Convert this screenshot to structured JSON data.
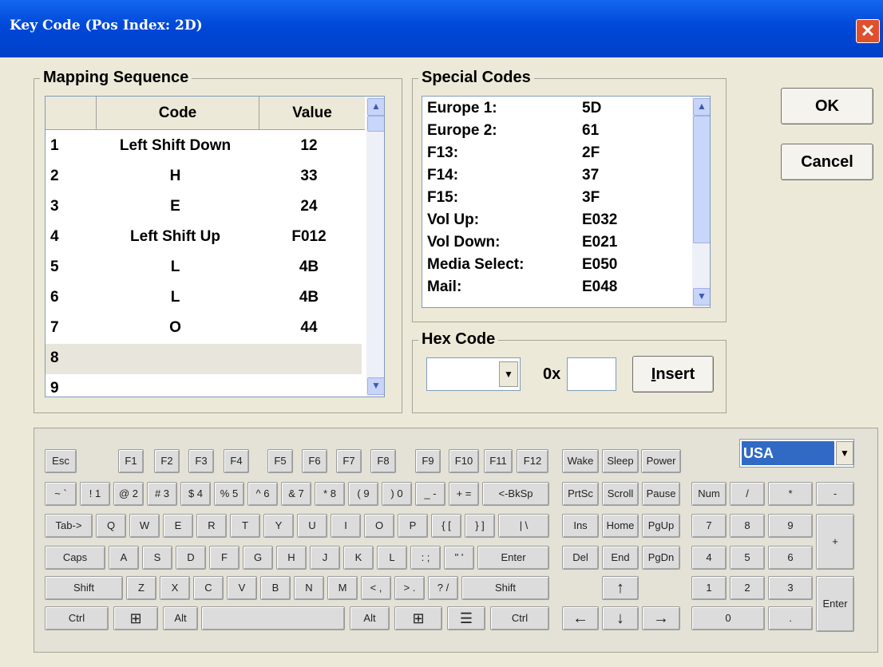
{
  "window": {
    "title": "Key Code (Pos Index: 2D)",
    "close_glyph": "✕"
  },
  "mapping": {
    "group_label": "Mapping Sequence",
    "headers": {
      "index": "",
      "code": "Code",
      "value": "Value"
    },
    "rows": [
      {
        "n": "1",
        "code": "Left Shift Down",
        "value": "12"
      },
      {
        "n": "2",
        "code": "H",
        "value": "33"
      },
      {
        "n": "3",
        "code": "E",
        "value": "24"
      },
      {
        "n": "4",
        "code": "Left Shift Up",
        "value": "F012"
      },
      {
        "n": "5",
        "code": "L",
        "value": "4B"
      },
      {
        "n": "6",
        "code": "L",
        "value": "4B"
      },
      {
        "n": "7",
        "code": "O",
        "value": "44"
      },
      {
        "n": "8",
        "code": "",
        "value": ""
      },
      {
        "n": "9",
        "code": "",
        "value": ""
      }
    ]
  },
  "special": {
    "group_label": "Special Codes",
    "items": [
      {
        "name": "Europe 1:",
        "code": "5D"
      },
      {
        "name": "Europe 2:",
        "code": "61"
      },
      {
        "name": "F13:",
        "code": "2F"
      },
      {
        "name": "F14:",
        "code": "37"
      },
      {
        "name": "F15:",
        "code": "3F"
      },
      {
        "name": "Vol Up:",
        "code": "E032"
      },
      {
        "name": "Vol Down:",
        "code": "E021"
      },
      {
        "name": "Media Select:",
        "code": "E050"
      },
      {
        "name": "Mail:",
        "code": "E048"
      }
    ]
  },
  "hex": {
    "group_label": "Hex Code",
    "prefix": "0x",
    "insert_label": "Insert",
    "insert_mnemonic": "I",
    "insert_rest": "nsert",
    "dropdown_value": "",
    "input_value": ""
  },
  "buttons": {
    "ok": "OK",
    "cancel": "Cancel"
  },
  "layout_select": {
    "value": "USA"
  },
  "scroll_glyphs": {
    "up": "▲",
    "down": "▼"
  },
  "keyboard": {
    "esc": "Esc",
    "fkeys": [
      "F1",
      "F2",
      "F3",
      "F4",
      "F5",
      "F6",
      "F7",
      "F8",
      "F9",
      "F10",
      "F11",
      "F12"
    ],
    "wake": "Wake",
    "sleep": "Sleep",
    "power": "Power",
    "row1": [
      "~ `",
      "! 1",
      "@ 2",
      "# 3",
      "$ 4",
      "% 5",
      "^ 6",
      "& 7",
      "* 8",
      "( 9",
      ") 0",
      "_ -",
      "+ =",
      "<-BkSp"
    ],
    "row2": [
      "Tab->",
      "Q",
      "W",
      "E",
      "R",
      "T",
      "Y",
      "U",
      "I",
      "O",
      "P",
      "{ [",
      "} ]",
      "| \\"
    ],
    "row3": [
      "Caps",
      "A",
      "S",
      "D",
      "F",
      "G",
      "H",
      "J",
      "K",
      "L",
      ": ;",
      "\" '",
      "Enter"
    ],
    "row4": [
      "Shift",
      "Z",
      "X",
      "C",
      "V",
      "B",
      "N",
      "M",
      "< ,",
      "> .",
      "? /",
      "Shift"
    ],
    "row5": {
      "ctrl_l": "Ctrl",
      "win_l": "⊞",
      "alt_l": "Alt",
      "space": "",
      "alt_r": "Alt",
      "win_r": "⊞",
      "menu": "☰",
      "ctrl_r": "Ctrl"
    },
    "nav": {
      "prtsc": "PrtSc",
      "scroll": "Scroll",
      "pause": "Pause",
      "ins": "Ins",
      "home": "Home",
      "pgup": "PgUp",
      "del": "Del",
      "end": "End",
      "pgdn": "PgDn",
      "up": "↑",
      "left": "←",
      "down": "↓",
      "right": "→"
    },
    "numpad": {
      "num": "Num",
      "div": "/",
      "mul": "*",
      "minus": "-",
      "n7": "7",
      "n8": "8",
      "n9": "9",
      "plus": "+",
      "n4": "4",
      "n5": "5",
      "n6": "6",
      "n1": "1",
      "n2": "2",
      "n3": "3",
      "enter": "Enter",
      "n0": "0",
      "dot": "."
    }
  }
}
